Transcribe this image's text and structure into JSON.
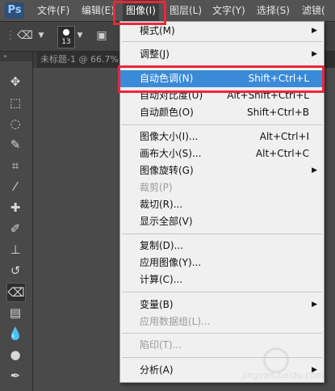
{
  "menubar": {
    "logo": "Ps",
    "items": [
      {
        "label": "文件(F)"
      },
      {
        "label": "编辑(E)"
      },
      {
        "label": "图像(I)"
      },
      {
        "label": "图层(L)"
      },
      {
        "label": "文字(Y)"
      },
      {
        "label": "选择(S)"
      },
      {
        "label": "滤镜("
      }
    ]
  },
  "options": {
    "brush_size": "13"
  },
  "document_tab": {
    "title": "未标题-1 @ 66.7%"
  },
  "image_menu": {
    "items": [
      {
        "label": "模式(M)",
        "shortcut": "",
        "submenu": true,
        "disabled": false
      },
      {
        "label": "调整(J)",
        "shortcut": "",
        "submenu": true,
        "disabled": false
      },
      {
        "label": "自动色调(N)",
        "shortcut": "Shift+Ctrl+L",
        "submenu": false,
        "disabled": false,
        "highlighted": true
      },
      {
        "label": "自动对比度(U)",
        "shortcut": "Alt+Shift+Ctrl+L",
        "submenu": false,
        "disabled": false
      },
      {
        "label": "自动颜色(O)",
        "shortcut": "Shift+Ctrl+B",
        "submenu": false,
        "disabled": false
      },
      {
        "label": "图像大小(I)...",
        "shortcut": "Alt+Ctrl+I",
        "submenu": false,
        "disabled": false
      },
      {
        "label": "画布大小(S)...",
        "shortcut": "Alt+Ctrl+C",
        "submenu": false,
        "disabled": false
      },
      {
        "label": "图像旋转(G)",
        "shortcut": "",
        "submenu": true,
        "disabled": false
      },
      {
        "label": "裁剪(P)",
        "shortcut": "",
        "submenu": false,
        "disabled": true
      },
      {
        "label": "裁切(R)...",
        "shortcut": "",
        "submenu": false,
        "disabled": false
      },
      {
        "label": "显示全部(V)",
        "shortcut": "",
        "submenu": false,
        "disabled": false
      },
      {
        "label": "复制(D)...",
        "shortcut": "",
        "submenu": false,
        "disabled": false
      },
      {
        "label": "应用图像(Y)...",
        "shortcut": "",
        "submenu": false,
        "disabled": false
      },
      {
        "label": "计算(C)...",
        "shortcut": "",
        "submenu": false,
        "disabled": false
      },
      {
        "label": "变量(B)",
        "shortcut": "",
        "submenu": true,
        "disabled": false
      },
      {
        "label": "应用数据组(L)...",
        "shortcut": "",
        "submenu": false,
        "disabled": true
      },
      {
        "label": "陷印(T)...",
        "shortcut": "",
        "submenu": false,
        "disabled": true
      },
      {
        "label": "分析(A)",
        "shortcut": "",
        "submenu": true,
        "disabled": false
      }
    ],
    "submenu_arrow": "▶"
  },
  "watermark": {
    "text": "jingyan.baidu.com"
  },
  "colors": {
    "highlight": "#3b8ad8",
    "annotation": "#e8283a"
  }
}
